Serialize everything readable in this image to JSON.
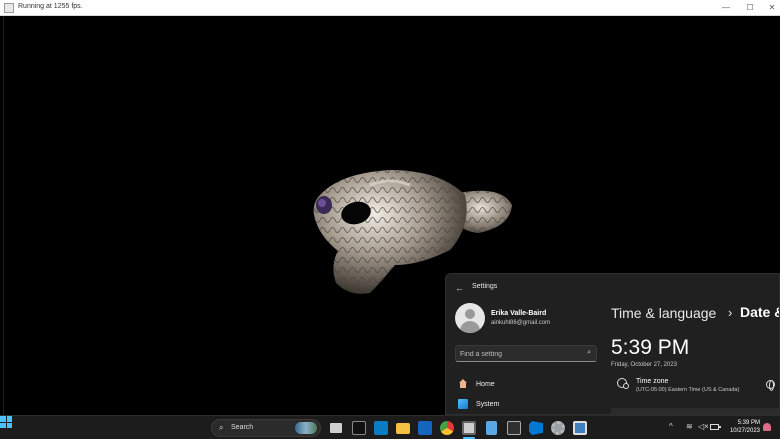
{
  "render_window": {
    "title": "Running at 1255 fps.",
    "minimize_glyph": "—",
    "maximize_glyph": "☐",
    "close_glyph": "✕"
  },
  "settings": {
    "app_title": "Settings",
    "back_glyph": "←",
    "user": {
      "name": "Erika Valle-Baird",
      "email": "ainkuhl86@gmail.com"
    },
    "search_placeholder": "Find a setting",
    "nav": [
      {
        "label": "Home",
        "icon": "home-icon"
      },
      {
        "label": "System",
        "icon": "system-icon"
      }
    ],
    "breadcrumb": {
      "parent": "Time & language",
      "separator": "›",
      "current": "Date &"
    },
    "time": "5:39 PM",
    "date": "Friday, October 27, 2023",
    "time_zone": {
      "label": "Time zone",
      "value": "(UTC-05:00) Eastern Time (US & Canada)"
    }
  },
  "taskbar": {
    "search_label": "Search",
    "search_glyph": "⌕",
    "chevron": "^",
    "wifi_glyph": "≋",
    "speaker_glyph": "◁×",
    "clock_time": "5:39 PM",
    "clock_date": "10/27/2023",
    "accent": "#4cc2ff"
  }
}
